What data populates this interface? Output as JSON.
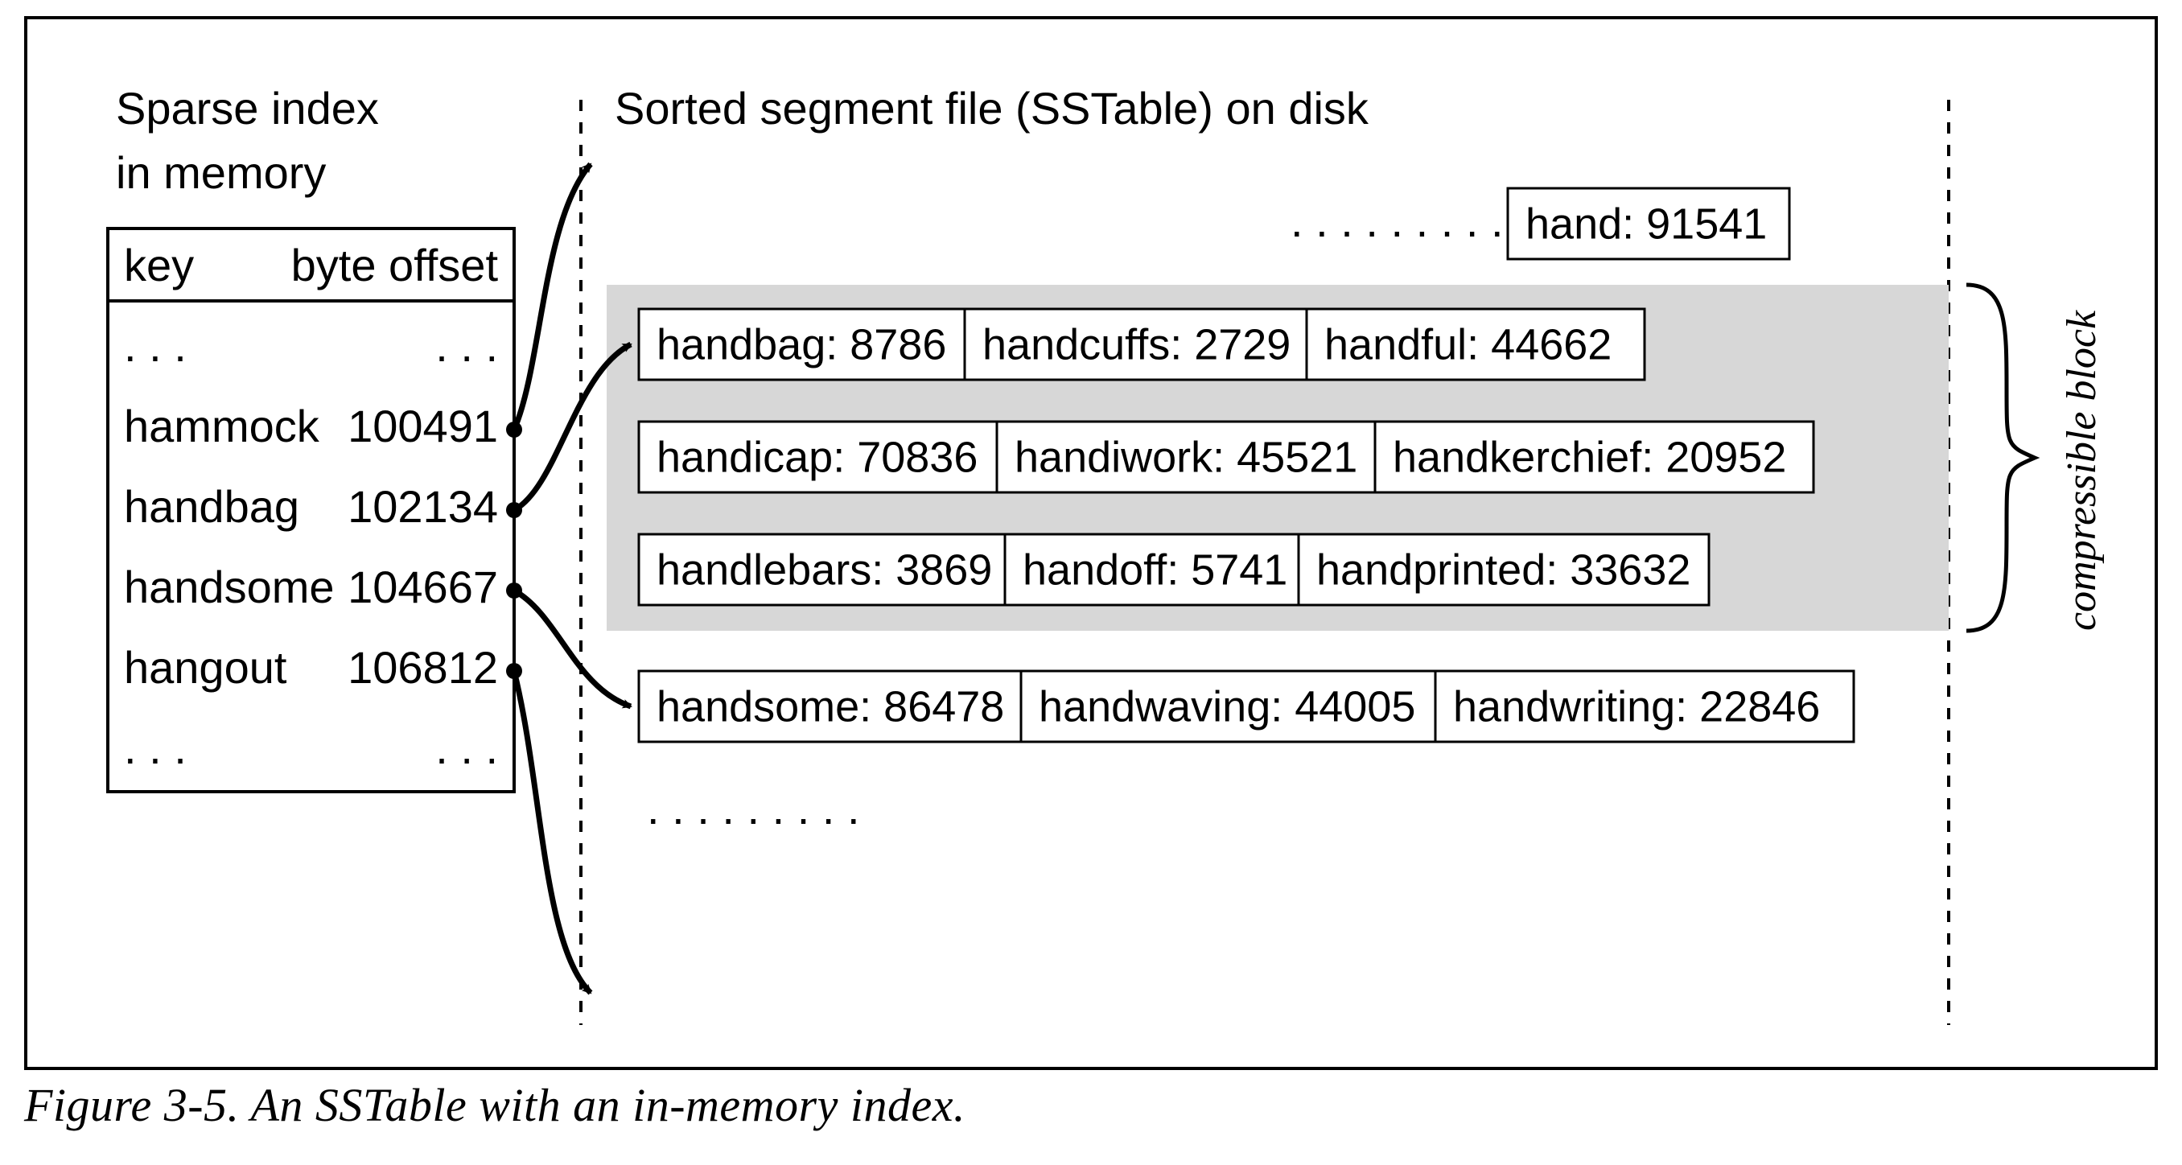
{
  "titles": {
    "left1": "Sparse index",
    "left2": "in memory",
    "right": "Sorted segment file (SSTable) on disk"
  },
  "index_table": {
    "headers": {
      "key": "key",
      "offset": "byte offset"
    },
    "ellipsis": ". . .",
    "rows": [
      {
        "key": "hammock",
        "offset": "100491"
      },
      {
        "key": "handbag",
        "offset": "102134"
      },
      {
        "key": "handsome",
        "offset": "104667"
      },
      {
        "key": "hangout",
        "offset": "106812"
      }
    ]
  },
  "sstable": {
    "before_dots": ". . . . . . . . .",
    "top_entry": "hand: 91541",
    "block_rows": [
      [
        "handbag: 8786",
        "handcuffs: 2729",
        "handful: 44662"
      ],
      [
        "handicap: 70836",
        "handiwork: 45521",
        "handkerchief: 20952"
      ],
      [
        "handlebars: 3869",
        "handoff: 5741",
        "handprinted: 33632"
      ]
    ],
    "after_row": [
      "handsome: 86478",
      "handwaving: 44005",
      "handwriting: 22846"
    ],
    "after_dots": ". . . . . . . . ."
  },
  "brace_label": "compressible block",
  "caption": "Figure 3-5. An SSTable with an in-memory index."
}
